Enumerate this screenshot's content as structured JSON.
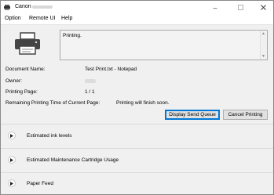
{
  "window": {
    "title": "Canon"
  },
  "menu": {
    "items": [
      "Option",
      "Remote UI",
      "Help"
    ]
  },
  "status": {
    "text": "Printing."
  },
  "info": {
    "document_name_label": "Document Name:",
    "document_name_value": "Test Print.txt - Notepad",
    "owner_label": "Owner:",
    "printing_page_label": "Printing Page:",
    "printing_page_value": "1 / 1",
    "remaining_label": "Remaining Printing Time of Current Page:",
    "remaining_value": "Printing will finish soon."
  },
  "buttons": {
    "display_send_queue": "Display Send Queue",
    "cancel_printing": "Cancel Printing"
  },
  "sections": [
    {
      "label": "Estimated ink levels"
    },
    {
      "label": "Estimated Maintenance Cartridge Usage"
    },
    {
      "label": "Paper Feed"
    }
  ]
}
